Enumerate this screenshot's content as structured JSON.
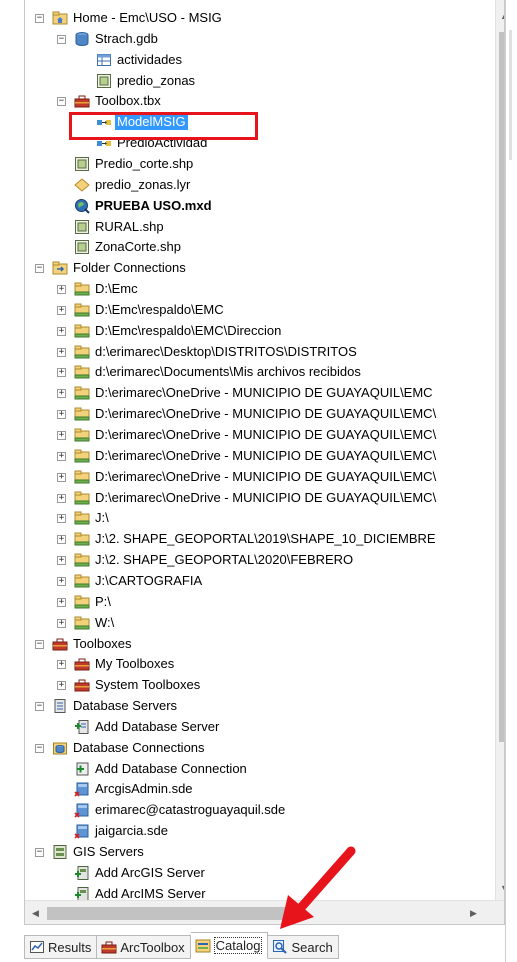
{
  "tree": {
    "items": [
      {
        "label": "Home - Emc\\USO - MSIG",
        "expander": "minus",
        "icon": "home-folder-icon"
      },
      {
        "label": "Strach.gdb",
        "expander": "minus",
        "icon": "geodatabase-icon"
      },
      {
        "label": "actividades",
        "icon": "table-icon"
      },
      {
        "label": "predio_zonas",
        "icon": "feature-class-icon"
      },
      {
        "label": "Toolbox.tbx",
        "expander": "minus",
        "icon": "toolbox-icon"
      },
      {
        "label": "ModelMSIG",
        "icon": "model-icon",
        "selected": true
      },
      {
        "label": "PredioActividad",
        "icon": "model-icon"
      },
      {
        "label": "Predio_corte.shp",
        "icon": "shapefile-icon"
      },
      {
        "label": "predio_zonas.lyr",
        "icon": "layer-file-icon"
      },
      {
        "label": "PRUEBA USO.mxd",
        "icon": "map-document-icon",
        "bold": true
      },
      {
        "label": "RURAL.shp",
        "icon": "shapefile-icon"
      },
      {
        "label": "ZonaCorte.shp",
        "icon": "shapefile-icon"
      },
      {
        "label": "Folder Connections",
        "expander": "minus",
        "icon": "folder-connections-icon"
      },
      {
        "label": "D:\\Emc",
        "expander": "plus",
        "icon": "folder-icon"
      },
      {
        "label": "D:\\Emc\\respaldo\\EMC",
        "expander": "plus",
        "icon": "folder-icon"
      },
      {
        "label": "D:\\Emc\\respaldo\\EMC\\Direccion",
        "expander": "plus",
        "icon": "folder-icon"
      },
      {
        "label": "d:\\erimarec\\Desktop\\DISTRITOS\\DISTRITOS",
        "expander": "plus",
        "icon": "folder-icon"
      },
      {
        "label": "d:\\erimarec\\Documents\\Mis archivos recibidos",
        "expander": "plus",
        "icon": "folder-icon"
      },
      {
        "label": "D:\\erimarec\\OneDrive - MUNICIPIO DE GUAYAQUIL\\EMC",
        "expander": "plus",
        "icon": "folder-icon"
      },
      {
        "label": "D:\\erimarec\\OneDrive - MUNICIPIO DE GUAYAQUIL\\EMC\\",
        "expander": "plus",
        "icon": "folder-icon"
      },
      {
        "label": "D:\\erimarec\\OneDrive - MUNICIPIO DE GUAYAQUIL\\EMC\\",
        "expander": "plus",
        "icon": "folder-icon"
      },
      {
        "label": "D:\\erimarec\\OneDrive - MUNICIPIO DE GUAYAQUIL\\EMC\\",
        "expander": "plus",
        "icon": "folder-icon"
      },
      {
        "label": "D:\\erimarec\\OneDrive - MUNICIPIO DE GUAYAQUIL\\EMC\\",
        "expander": "plus",
        "icon": "folder-icon"
      },
      {
        "label": "D:\\erimarec\\OneDrive - MUNICIPIO DE GUAYAQUIL\\EMC\\",
        "expander": "plus",
        "icon": "folder-icon"
      },
      {
        "label": "J:\\",
        "expander": "plus",
        "icon": "folder-icon"
      },
      {
        "label": "J:\\2. SHAPE_GEOPORTAL\\2019\\SHAPE_10_DICIEMBRE",
        "expander": "plus",
        "icon": "folder-icon"
      },
      {
        "label": "J:\\2. SHAPE_GEOPORTAL\\2020\\FEBRERO",
        "expander": "plus",
        "icon": "folder-icon"
      },
      {
        "label": "J:\\CARTOGRAFIA",
        "expander": "plus",
        "icon": "folder-icon"
      },
      {
        "label": "P:\\",
        "expander": "plus",
        "icon": "folder-icon"
      },
      {
        "label": "W:\\",
        "expander": "plus",
        "icon": "folder-icon"
      },
      {
        "label": "Toolboxes",
        "expander": "minus",
        "icon": "toolboxes-icon"
      },
      {
        "label": "My Toolboxes",
        "expander": "plus",
        "icon": "toolbox-icon"
      },
      {
        "label": "System Toolboxes",
        "expander": "plus",
        "icon": "toolbox-icon"
      },
      {
        "label": "Database Servers",
        "expander": "minus",
        "icon": "database-servers-icon"
      },
      {
        "label": "Add Database Server",
        "icon": "add-database-server-icon"
      },
      {
        "label": "Database Connections",
        "expander": "minus",
        "icon": "database-connections-icon"
      },
      {
        "label": "Add Database Connection",
        "icon": "add-database-connection-icon"
      },
      {
        "label": "ArcgisAdmin.sde",
        "icon": "sde-connection-icon"
      },
      {
        "label": "erimarec@catastroguayaquil.sde",
        "icon": "sde-connection-icon"
      },
      {
        "label": "jaigarcia.sde",
        "icon": "sde-connection-icon"
      },
      {
        "label": "GIS Servers",
        "expander": "minus",
        "icon": "gis-servers-icon"
      },
      {
        "label": "Add ArcGIS Server",
        "icon": "add-arcgis-server-icon"
      },
      {
        "label": "Add ArcIMS Server",
        "icon": "add-arcims-server-icon"
      }
    ]
  },
  "tabs": [
    {
      "label": "Results",
      "icon": "results-icon"
    },
    {
      "label": "ArcToolbox",
      "icon": "arctoolbox-icon"
    },
    {
      "label": "Catalog",
      "icon": "catalog-icon",
      "active": true
    },
    {
      "label": "Search",
      "icon": "search-icon"
    }
  ],
  "colors": {
    "selection": "#3399ff",
    "annotation": "#e8141c",
    "folder": "#f2d27a",
    "toolbox": "#c0392b"
  }
}
